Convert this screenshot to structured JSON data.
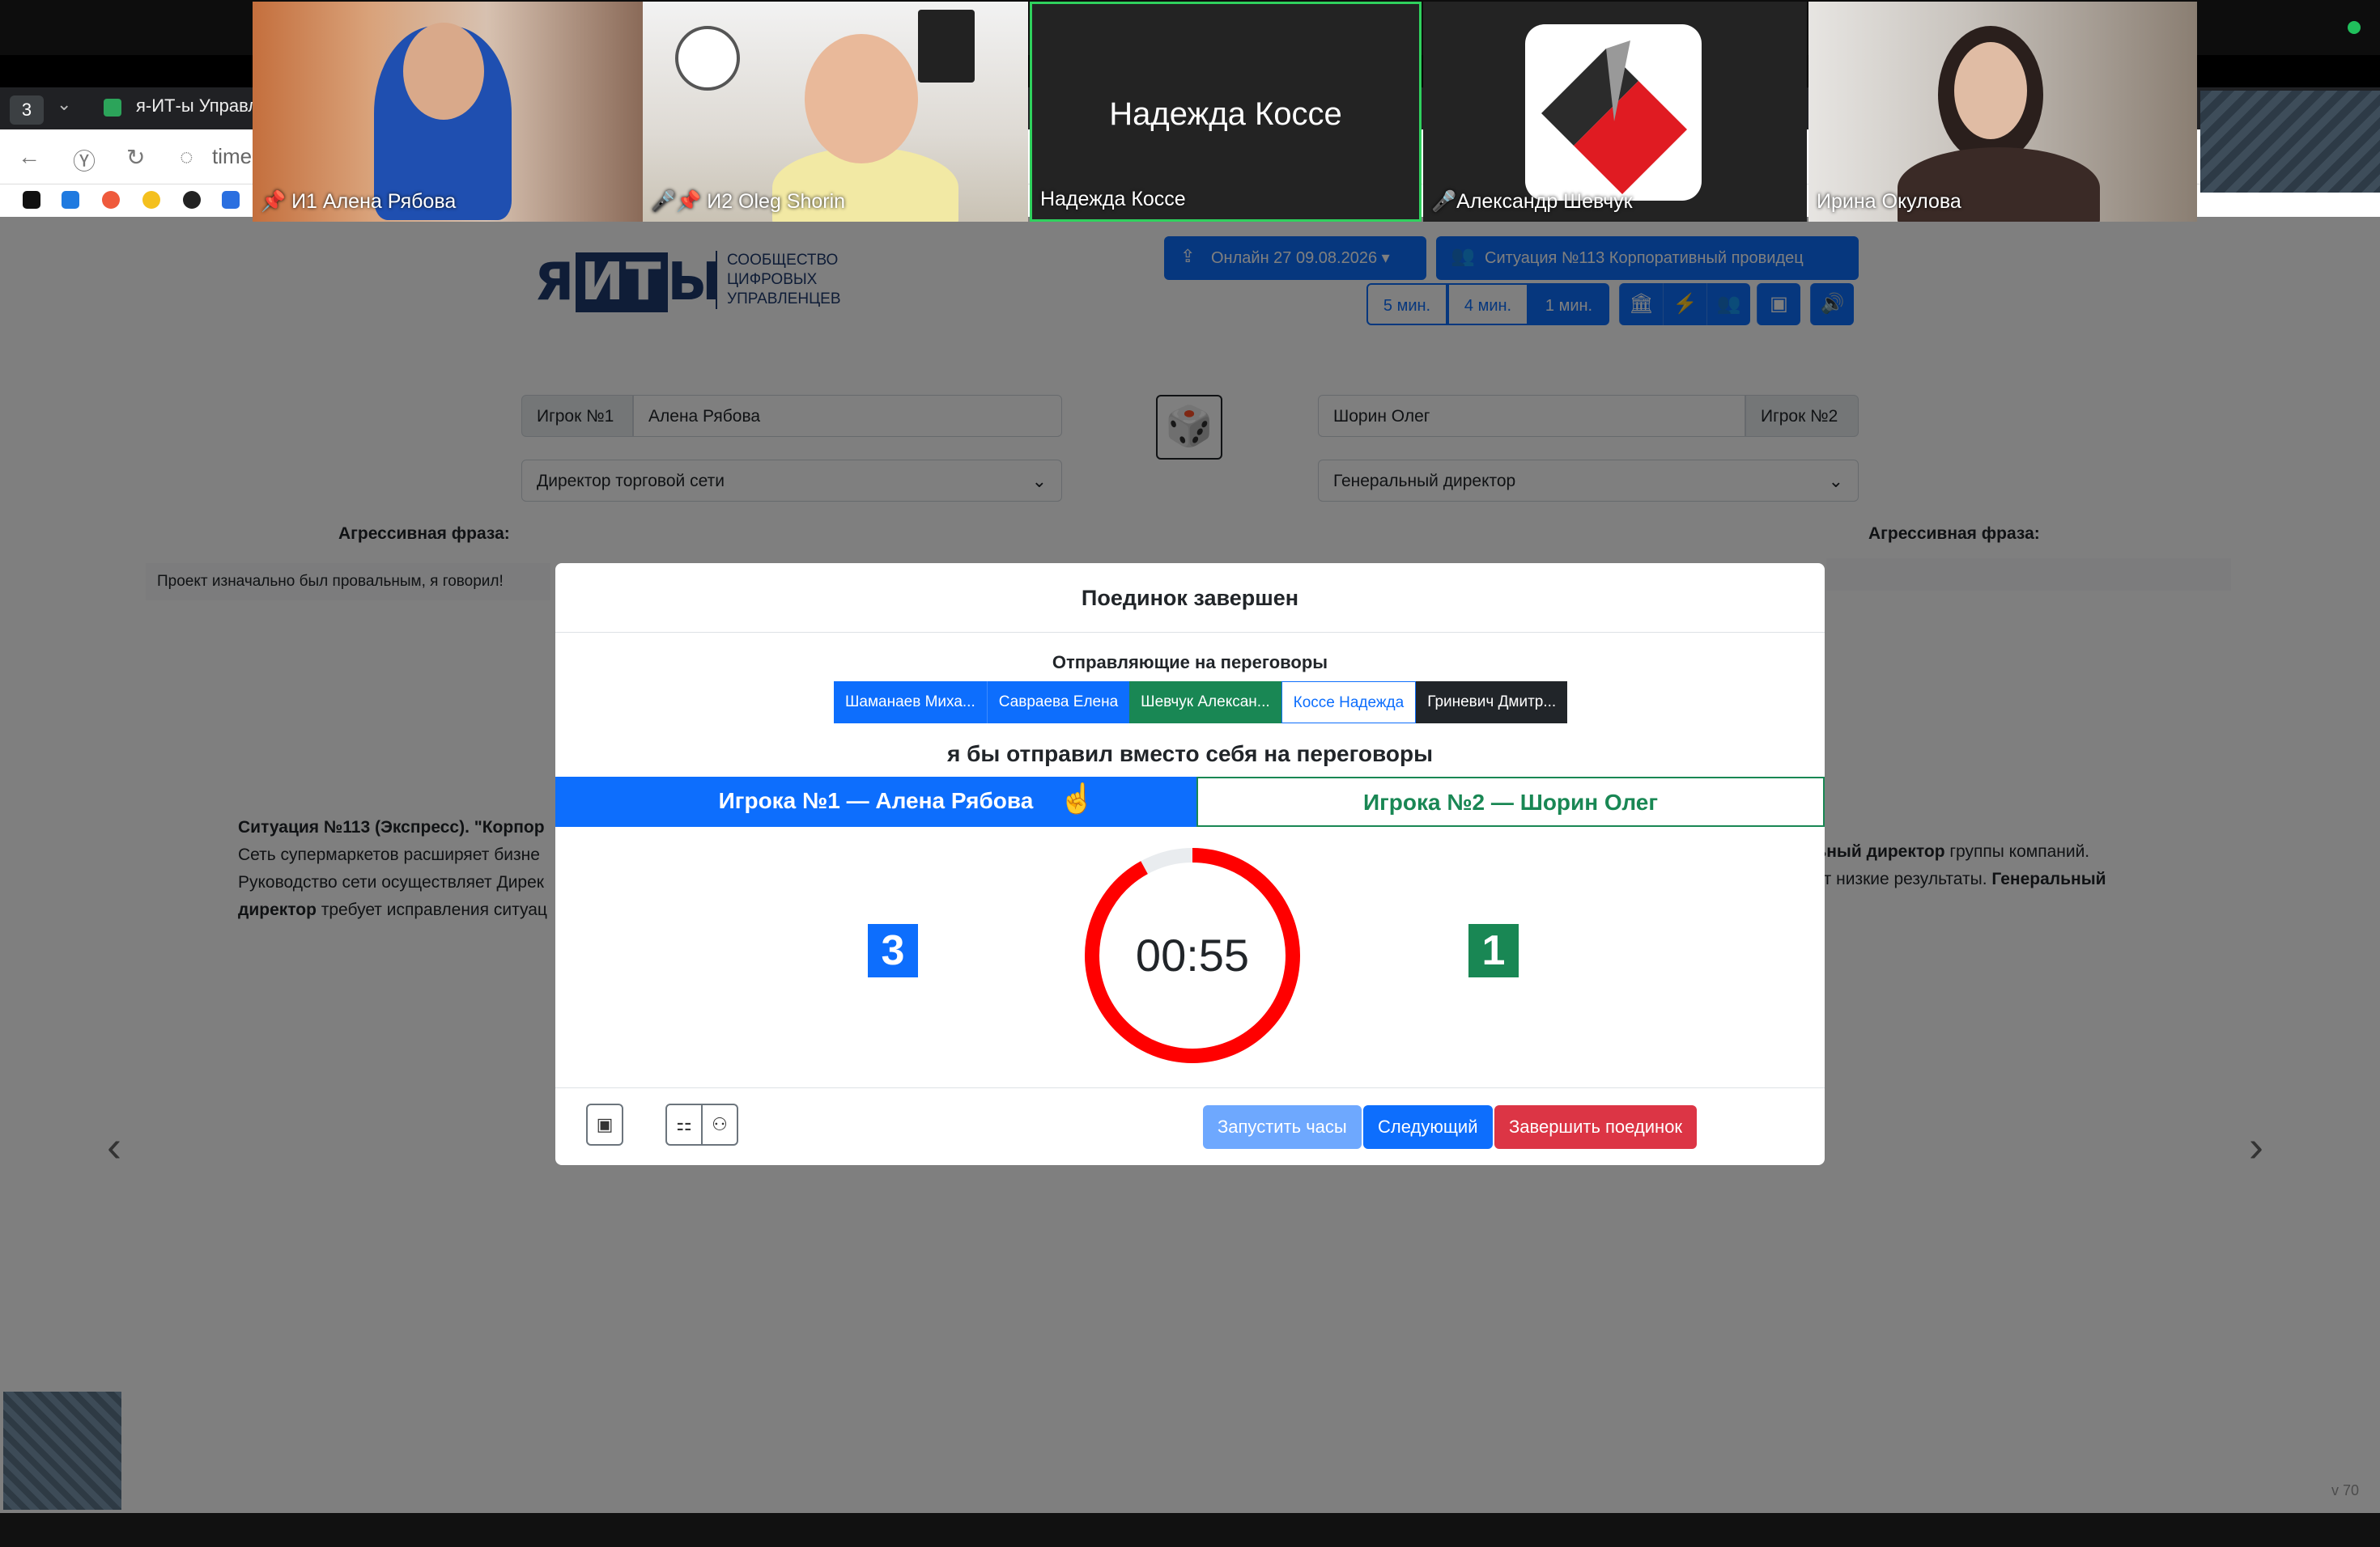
{
  "zoom": {
    "participants": [
      {
        "name": "И1 Алена Рябова",
        "pinned": true,
        "muted": false
      },
      {
        "name": "И2 Oleg Shorin",
        "pinned": true,
        "muted": true
      },
      {
        "name": "Надежда Коссе",
        "big_name": "Надежда Коссе",
        "active_speaker": true
      },
      {
        "name": "Александр Шевчук",
        "muted": true
      },
      {
        "name": "Ирина Окулова",
        "muted": false
      }
    ]
  },
  "browser": {
    "tab_count": "3",
    "tab_title": "я-ИТ-ы Управле",
    "url_partial": "time"
  },
  "header": {
    "logo_main_pre": "Я",
    "logo_main_it": "ИТ",
    "logo_main_post": "Ы",
    "logo_sub": "Сообщество цифровых управленцев",
    "online_label": "Онлайн 27 09.08.2026",
    "situation_label": "Ситуация №113 Корпоративный провидец",
    "timers": [
      "5 мин.",
      "4 мин.",
      "1 мин."
    ],
    "selected_timer": "1 мин."
  },
  "players": {
    "p1_label": "Игрок №1",
    "p1_name": "Алена Рябова",
    "p1_role": "Директор торговой сети",
    "p2_label": "Игрок №2",
    "p2_name": "Шорин Олег",
    "p2_role": "Генеральный директор",
    "agg_label": "Агрессивная фраза:",
    "p1_agg_text": "Проект изначально был провальным, я говорил!"
  },
  "situation": {
    "left_html_parts": [
      "Ситуация №113 (Экспресс). \"Корпор",
      "Сеть супермаркетов расширяет бизне",
      "Руководство сети осуществляет Дирек",
      "директор",
      " требует исправления ситуац"
    ],
    "right_parts": [
      "льный директор",
      " группы компаний.",
      "ает низкие результаты. ",
      "Генеральный"
    ]
  },
  "modal": {
    "title": "Поединок завершен",
    "senders_title": "Отправляющие на переговоры",
    "senders": [
      "Шаманаев Миха...",
      "Савраева Елена",
      "Шевчук Алексан...",
      "Коссе Надежда",
      "Гриневич Дмитр..."
    ],
    "question": "я бы отправил вместо себя на переговоры",
    "player1_tab": "Игрока №1 — Алена Рябова",
    "player2_tab": "Игрока №2 — Шорин Олег",
    "score_p1": "3",
    "score_p2": "1",
    "timer": "00:55",
    "timer_fraction_remaining": 0.92,
    "buttons": {
      "start": "Запустить часы",
      "next": "Следующий",
      "finish": "Завершить поединок"
    }
  },
  "version": "v 70",
  "colors": {
    "primary": "#0d6efd",
    "success": "#198754",
    "danger": "#dc3545",
    "ring": "#ff0000"
  }
}
